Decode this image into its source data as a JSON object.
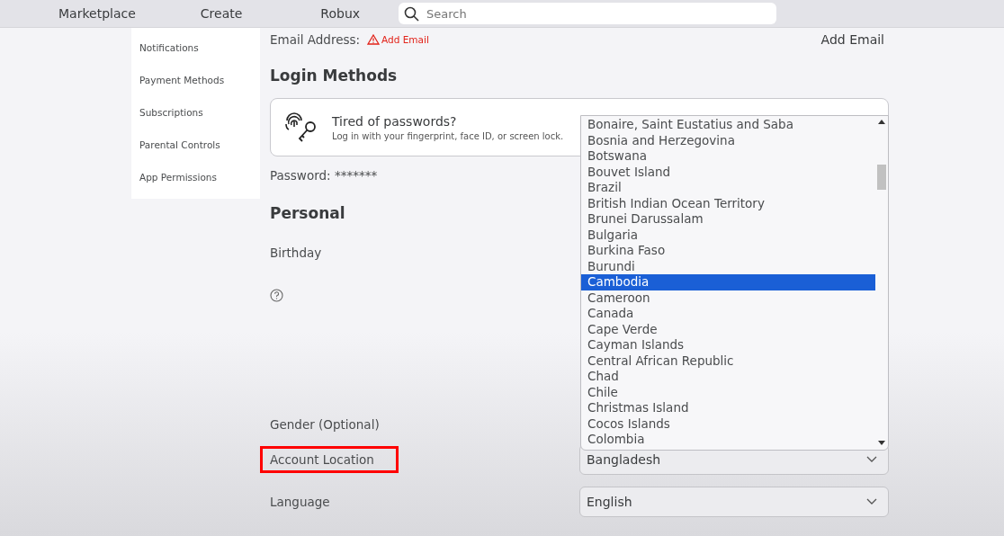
{
  "nav": {
    "items": [
      "Marketplace",
      "Create",
      "Robux"
    ],
    "search": {
      "placeholder": "Search"
    }
  },
  "sidebar": {
    "items": [
      {
        "label": "Notifications",
        "selected": false
      },
      {
        "label": "Payment Methods",
        "selected": false
      },
      {
        "label": "Subscriptions",
        "selected": false
      },
      {
        "label": "Parental Controls",
        "selected": false
      },
      {
        "label": "App Permissions",
        "selected": false
      }
    ]
  },
  "email": {
    "label": "Email Address:",
    "warning": "Add Email",
    "button": "Add Email"
  },
  "login": {
    "heading": "Login Methods",
    "card_title": "Tired of passwords?",
    "card_text": "Log in with your fingerprint, face ID, or screen lock.",
    "password": "Password: *******"
  },
  "personal": {
    "heading": "Personal",
    "birthday": "Birthday",
    "gender": "Gender (Optional)",
    "location": {
      "label": "Account Location",
      "value": "Bangladesh",
      "highlighted": true
    },
    "language": {
      "label": "Language",
      "value": "English"
    }
  },
  "dropdown": {
    "options": [
      {
        "label": "Bonaire, Saint Eustatius and Saba",
        "selected": false
      },
      {
        "label": "Bosnia and Herzegovina",
        "selected": false
      },
      {
        "label": "Botswana",
        "selected": false
      },
      {
        "label": "Bouvet Island",
        "selected": false
      },
      {
        "label": "Brazil",
        "selected": false
      },
      {
        "label": "British Indian Ocean Territory",
        "selected": false
      },
      {
        "label": "Brunei Darussalam",
        "selected": false
      },
      {
        "label": "Bulgaria",
        "selected": false
      },
      {
        "label": "Burkina Faso",
        "selected": false
      },
      {
        "label": "Burundi",
        "selected": false
      },
      {
        "label": "Cambodia",
        "selected": true
      },
      {
        "label": "Cameroon",
        "selected": false
      },
      {
        "label": "Canada",
        "selected": false
      },
      {
        "label": "Cape Verde",
        "selected": false
      },
      {
        "label": "Cayman Islands",
        "selected": false
      },
      {
        "label": "Central African Republic",
        "selected": false
      },
      {
        "label": "Chad",
        "selected": false
      },
      {
        "label": "Chile",
        "selected": false
      },
      {
        "label": "Christmas Island",
        "selected": false
      },
      {
        "label": "Cocos Islands",
        "selected": false
      },
      {
        "label": "Colombia",
        "selected": false
      }
    ]
  }
}
